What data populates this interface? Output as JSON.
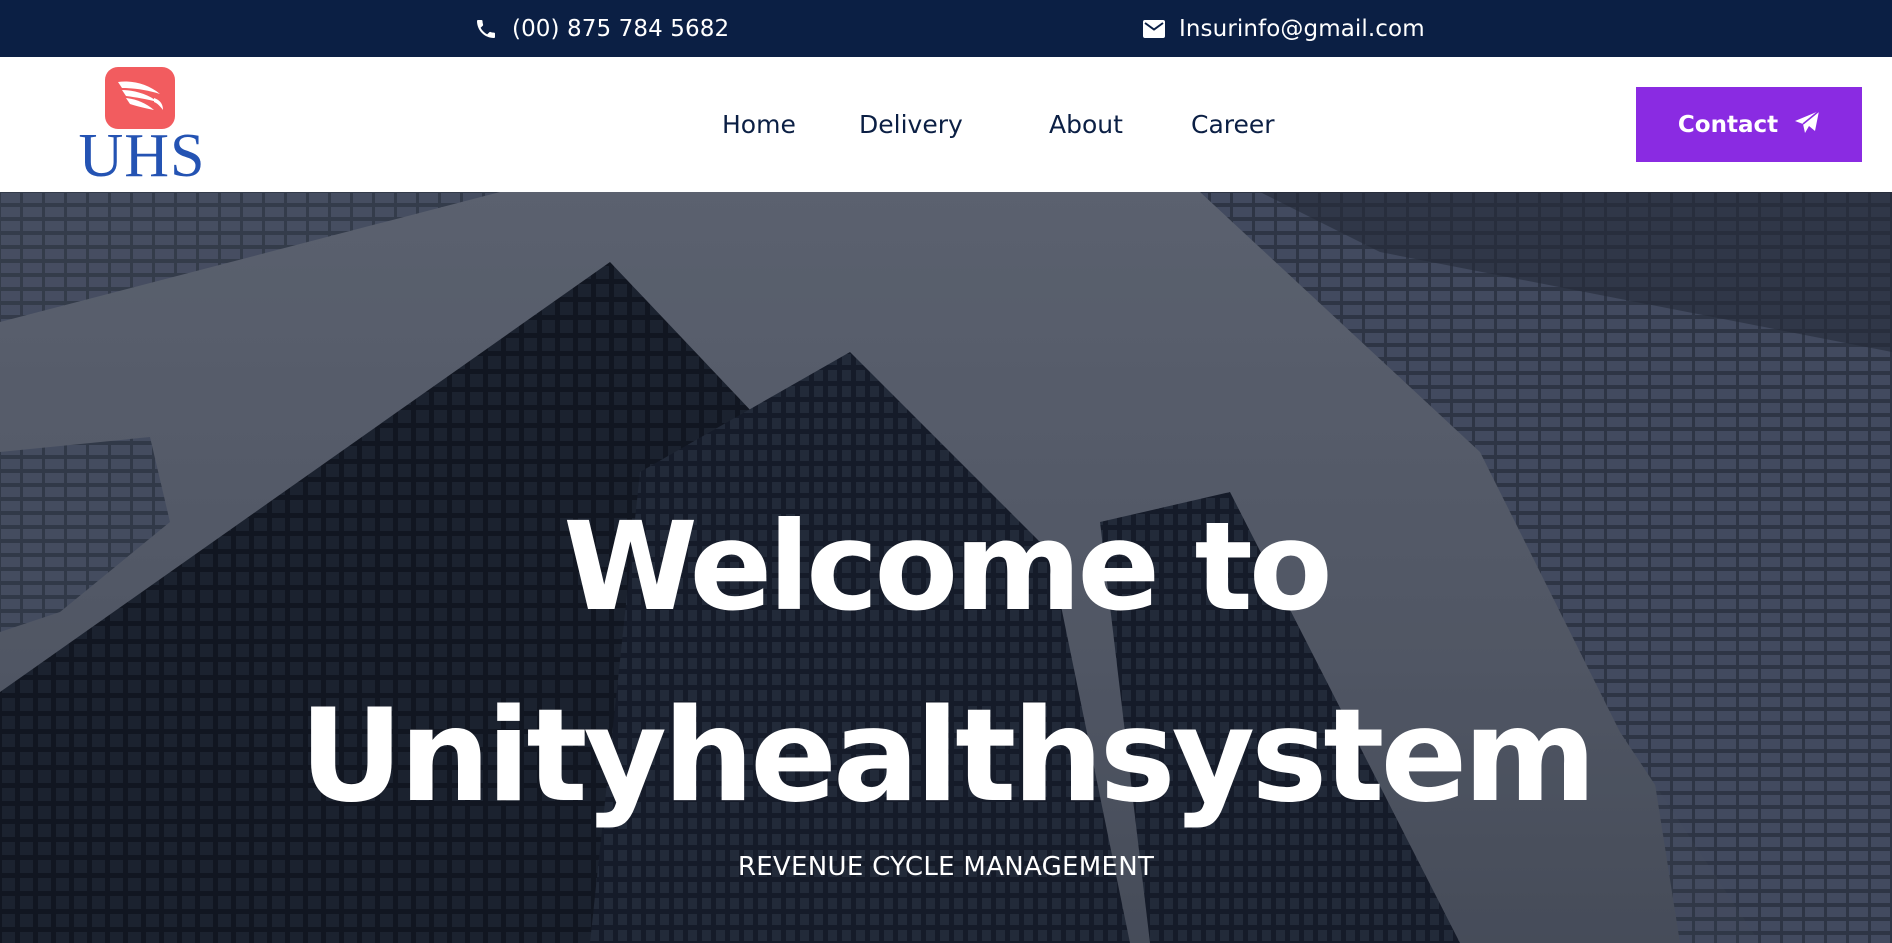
{
  "topbar": {
    "phone": "(00) 875 784 5682",
    "phone_icon": "phone-icon",
    "email": "Insurinfo@gmail.com",
    "email_icon": "envelope-icon",
    "background": "#0b1f44"
  },
  "header": {
    "logo_text": "UHS",
    "logo_icon": "wing-icon",
    "logo_badge_color": "#f25c5f",
    "logo_text_color": "#2453b3",
    "nav": [
      {
        "label": "Home"
      },
      {
        "label": "Delivery"
      },
      {
        "label": "About"
      },
      {
        "label": "Career"
      }
    ],
    "contact_button": {
      "label": "Contact",
      "icon": "paper-plane-icon",
      "color": "#8a2be2"
    }
  },
  "hero": {
    "title_line1": "Welcome to",
    "title_line2": "Unityhealthsystem",
    "subtitle": "REVENUE CYCLE MANAGEMENT",
    "background_image": "skyscrapers-from-below"
  }
}
